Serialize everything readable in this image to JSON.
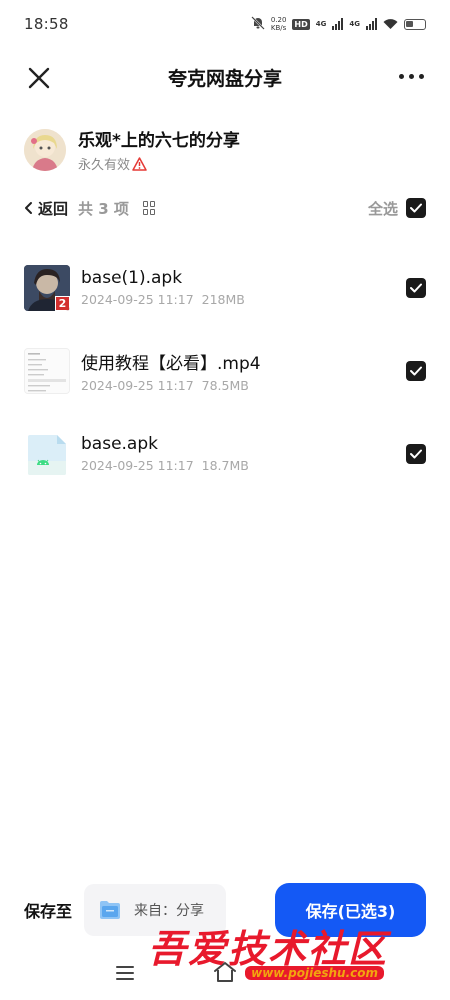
{
  "status_bar": {
    "time": "18:58",
    "speed": "0.20",
    "speed_unit": "KB/s",
    "network_1": "4G",
    "network_2": "4G",
    "hd": "HD"
  },
  "header": {
    "title": "夸克网盘分享"
  },
  "sharer": {
    "name": "乐观*上的六七的分享",
    "validity": "永久有效"
  },
  "toolbar": {
    "back_label": "返回",
    "count_label": "共 3 项",
    "select_all_label": "全选"
  },
  "files": [
    {
      "name": "base(1).apk",
      "date": "2024-09-25 11:17",
      "size": "218MB",
      "badge": "2"
    },
    {
      "name": "使用教程【必看】.mp4",
      "date": "2024-09-25 11:17",
      "size": "78.5MB"
    },
    {
      "name": "base.apk",
      "date": "2024-09-25 11:17",
      "size": "18.7MB"
    }
  ],
  "bottom": {
    "save_to_label": "保存至",
    "destination": "来自：分享",
    "save_button": "保存(已选3)"
  },
  "watermark": {
    "text": "吾爱技术社区",
    "url": "www.pojieshu.com"
  },
  "colors": {
    "primary": "#1459f5",
    "checkbox": "#1a1a1a",
    "warning": "#e53935",
    "watermark_red": "#e8192c"
  }
}
